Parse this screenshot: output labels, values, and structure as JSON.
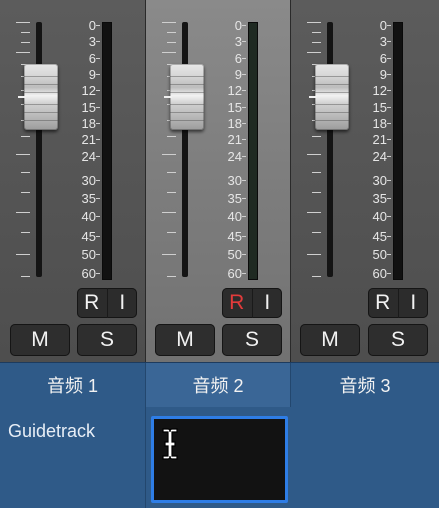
{
  "channels": [
    {
      "name": "音频 1",
      "record_label": "R",
      "input_label": "I",
      "record_armed": false,
      "mute_label": "M",
      "solo_label": "S",
      "selected": false,
      "fader_level_db": 0
    },
    {
      "name": "音频 2",
      "record_label": "R",
      "input_label": "I",
      "record_armed": true,
      "mute_label": "M",
      "solo_label": "S",
      "selected": true,
      "fader_level_db": 0
    },
    {
      "name": "音频 3",
      "record_label": "R",
      "input_label": "I",
      "record_armed": false,
      "mute_label": "M",
      "solo_label": "S",
      "selected": false,
      "fader_level_db": 0
    }
  ],
  "meter_scale": [
    "0",
    "3",
    "6",
    "9",
    "12",
    "15",
    "18",
    "21",
    "24",
    "30",
    "35",
    "40",
    "45",
    "50",
    "60"
  ],
  "region_row": {
    "label": "Guidetrack",
    "text_field_value": ""
  },
  "colors": {
    "record_armed": "#e23b3b",
    "name_row_bg": "#2f5a88",
    "text_field_focus": "#2e7de6"
  },
  "icons": {
    "cursor": "ibeam-cursor-icon"
  }
}
